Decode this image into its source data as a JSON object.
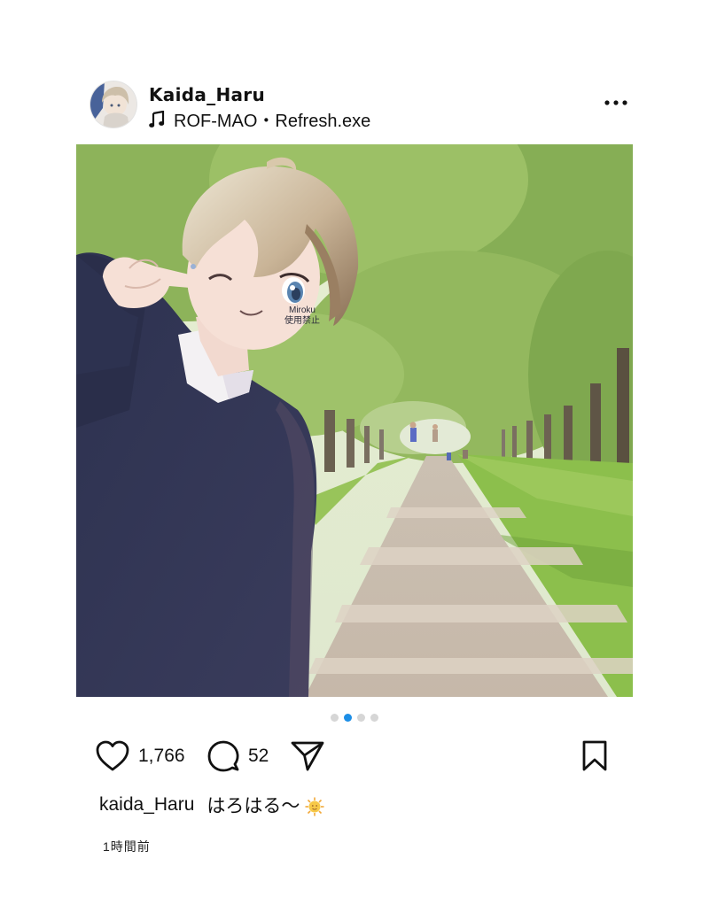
{
  "post": {
    "username": "Kaida_Haru",
    "music_icon": "music-note-icon",
    "music_label": "ROF-MAO・Refresh.exe",
    "more_icon": "more-horizontal-icon",
    "image_watermark": "Miroku\n使用禁止",
    "carousel": {
      "total": 4,
      "active_index": 1
    },
    "likes_count": "1,766",
    "comments_count": "52",
    "caption_user": "kaida_Haru",
    "caption_text": "はろはる〜",
    "caption_emoji": "sun-with-face-emoji",
    "timestamp": "1時間前"
  },
  "colors": {
    "active_dot": "#1c8ee6",
    "inactive_dot": "#d6d6d6"
  }
}
